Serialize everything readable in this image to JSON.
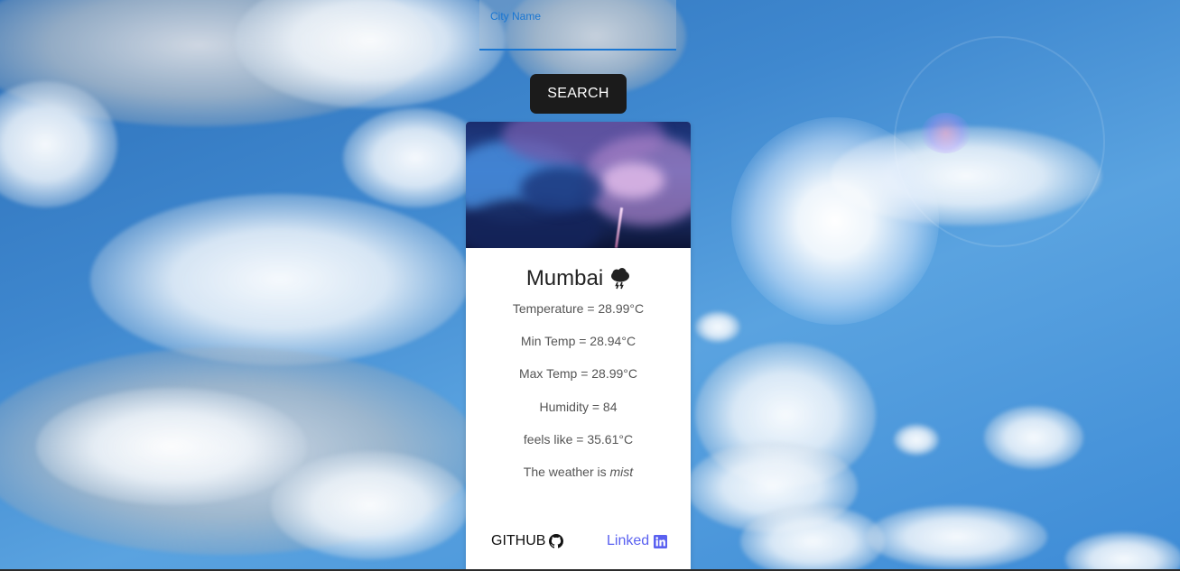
{
  "search": {
    "label": "City Name",
    "value": "",
    "button_label": "SEARCH"
  },
  "weather": {
    "city": "Mumbai",
    "icon": "thunderstorm-cloud-icon",
    "temperature": "Temperature = 28.99°C",
    "min_temp": "Min Temp = 28.94°C",
    "max_temp": "Max Temp = 28.99°C",
    "humidity": "Humidity = 84",
    "feels_like": "feels like = 35.61°C",
    "description_prefix": "The weather is ",
    "description": "mist"
  },
  "footer": {
    "github_label": "GITHUB",
    "github_icon": "github-icon",
    "linkedin_label": "Linked",
    "linkedin_icon": "linkedin-icon",
    "linkedin_color": "#5a61f0"
  },
  "colors": {
    "accent": "#1976d2",
    "button": "#1b1b1b"
  }
}
